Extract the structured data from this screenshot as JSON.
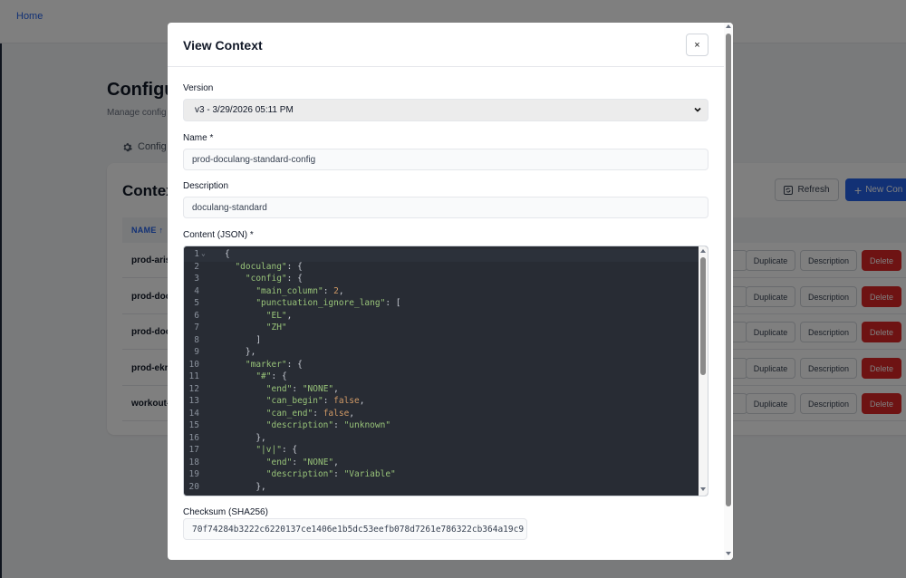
{
  "background": {
    "nav": {
      "home": "Home"
    },
    "page": {
      "title": "Configu",
      "subtitle": "Manage config"
    },
    "tab": {
      "label": "Config"
    },
    "card": {
      "title": "Contex",
      "refresh": "Refresh",
      "new": "New Con"
    },
    "table": {
      "header_name": "NAME ↑",
      "rows": [
        {
          "name": "prod-aris"
        },
        {
          "name": "prod-doc"
        },
        {
          "name": "prod-doc"
        },
        {
          "name": "prod-ekr"
        },
        {
          "name": "workout-"
        }
      ],
      "actions": {
        "duplicate": "Duplicate",
        "description": "Description",
        "delete": "Delete"
      }
    }
  },
  "modal": {
    "title": "View Context",
    "close": "×",
    "version": {
      "label": "Version",
      "selected": "v3 - 3/29/2026 05:11 PM"
    },
    "name": {
      "label": "Name *",
      "value": "prod-doculang-standard-config"
    },
    "description": {
      "label": "Description",
      "value": "doculang-standard"
    },
    "content": {
      "label": "Content (JSON) *",
      "lines": [
        [
          {
            "t": "{",
            "c": "p"
          }
        ],
        [
          {
            "t": "  ",
            "c": "p"
          },
          {
            "t": "\"doculang\"",
            "c": "k"
          },
          {
            "t": ": {",
            "c": "p"
          }
        ],
        [
          {
            "t": "    ",
            "c": "p"
          },
          {
            "t": "\"config\"",
            "c": "k"
          },
          {
            "t": ": {",
            "c": "p"
          }
        ],
        [
          {
            "t": "      ",
            "c": "p"
          },
          {
            "t": "\"main_column\"",
            "c": "k"
          },
          {
            "t": ": ",
            "c": "p"
          },
          {
            "t": "2",
            "c": "n"
          },
          {
            "t": ",",
            "c": "p"
          }
        ],
        [
          {
            "t": "      ",
            "c": "p"
          },
          {
            "t": "\"punctuation_ignore_lang\"",
            "c": "k"
          },
          {
            "t": ": [",
            "c": "p"
          }
        ],
        [
          {
            "t": "        ",
            "c": "p"
          },
          {
            "t": "\"EL\"",
            "c": "k"
          },
          {
            "t": ",",
            "c": "p"
          }
        ],
        [
          {
            "t": "        ",
            "c": "p"
          },
          {
            "t": "\"ZH\"",
            "c": "k"
          }
        ],
        [
          {
            "t": "      ]",
            "c": "p"
          }
        ],
        [
          {
            "t": "    },",
            "c": "p"
          }
        ],
        [
          {
            "t": "    ",
            "c": "p"
          },
          {
            "t": "\"marker\"",
            "c": "k"
          },
          {
            "t": ": {",
            "c": "p"
          }
        ],
        [
          {
            "t": "      ",
            "c": "p"
          },
          {
            "t": "\"#\"",
            "c": "k"
          },
          {
            "t": ": {",
            "c": "p"
          }
        ],
        [
          {
            "t": "        ",
            "c": "p"
          },
          {
            "t": "\"end\"",
            "c": "k"
          },
          {
            "t": ": ",
            "c": "p"
          },
          {
            "t": "\"NONE\"",
            "c": "k"
          },
          {
            "t": ",",
            "c": "p"
          }
        ],
        [
          {
            "t": "        ",
            "c": "p"
          },
          {
            "t": "\"can_begin\"",
            "c": "k"
          },
          {
            "t": ": ",
            "c": "p"
          },
          {
            "t": "false",
            "c": "b"
          },
          {
            "t": ",",
            "c": "p"
          }
        ],
        [
          {
            "t": "        ",
            "c": "p"
          },
          {
            "t": "\"can_end\"",
            "c": "k"
          },
          {
            "t": ": ",
            "c": "p"
          },
          {
            "t": "false",
            "c": "b"
          },
          {
            "t": ",",
            "c": "p"
          }
        ],
        [
          {
            "t": "        ",
            "c": "p"
          },
          {
            "t": "\"description\"",
            "c": "k"
          },
          {
            "t": ": ",
            "c": "p"
          },
          {
            "t": "\"unknown\"",
            "c": "k"
          }
        ],
        [
          {
            "t": "      },",
            "c": "p"
          }
        ],
        [
          {
            "t": "      ",
            "c": "p"
          },
          {
            "t": "\"|v|\"",
            "c": "k"
          },
          {
            "t": ": {",
            "c": "p"
          }
        ],
        [
          {
            "t": "        ",
            "c": "p"
          },
          {
            "t": "\"end\"",
            "c": "k"
          },
          {
            "t": ": ",
            "c": "p"
          },
          {
            "t": "\"NONE\"",
            "c": "k"
          },
          {
            "t": ",",
            "c": "p"
          }
        ],
        [
          {
            "t": "        ",
            "c": "p"
          },
          {
            "t": "\"description\"",
            "c": "k"
          },
          {
            "t": ": ",
            "c": "p"
          },
          {
            "t": "\"Variable\"",
            "c": "k"
          }
        ],
        [
          {
            "t": "      },",
            "c": "p"
          }
        ]
      ]
    },
    "checksum": {
      "label": "Checksum (SHA256)",
      "value": "70f74284b3222c6220137ce1406e1b5dc53eefb078d7261e786322cb364a19c9"
    }
  },
  "colors": {
    "primary": "#2563eb",
    "danger": "#dc2626",
    "editor_bg": "#282c34",
    "string": "#98c379",
    "number": "#d19a66"
  }
}
